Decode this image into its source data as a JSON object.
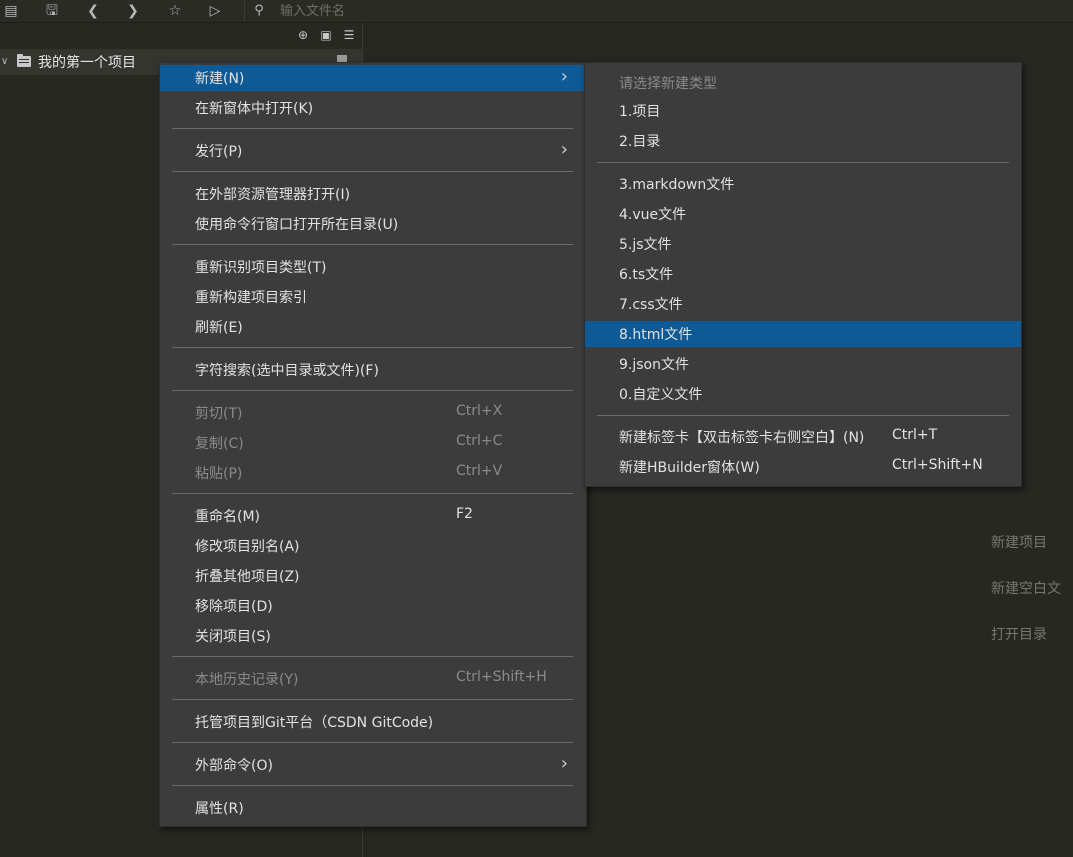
{
  "search": {
    "placeholder": "输入文件名"
  },
  "sidebar": {
    "project_name": "我的第一个项目"
  },
  "context_menu": {
    "items": [
      {
        "label": "新建(N)",
        "shortcut": "",
        "submenu": true,
        "disabled": false
      },
      {
        "label": "在新窗体中打开(K)",
        "shortcut": "",
        "submenu": false,
        "disabled": false
      },
      {
        "label": "发行(P)",
        "shortcut": "",
        "submenu": true,
        "disabled": false
      },
      {
        "label": "在外部资源管理器打开(I)",
        "shortcut": "",
        "submenu": false,
        "disabled": false
      },
      {
        "label": "使用命令行窗口打开所在目录(U)",
        "shortcut": "",
        "submenu": false,
        "disabled": false
      },
      {
        "label": "重新识别项目类型(T)",
        "shortcut": "",
        "submenu": false,
        "disabled": false
      },
      {
        "label": "重新构建项目索引",
        "shortcut": "",
        "submenu": false,
        "disabled": false
      },
      {
        "label": "刷新(E)",
        "shortcut": "",
        "submenu": false,
        "disabled": false
      },
      {
        "label": "字符搜索(选中目录或文件)(F)",
        "shortcut": "",
        "submenu": false,
        "disabled": false
      },
      {
        "label": "剪切(T)",
        "shortcut": "Ctrl+X",
        "submenu": false,
        "disabled": true
      },
      {
        "label": "复制(C)",
        "shortcut": "Ctrl+C",
        "submenu": false,
        "disabled": true
      },
      {
        "label": "粘贴(P)",
        "shortcut": "Ctrl+V",
        "submenu": false,
        "disabled": true
      },
      {
        "label": "重命名(M)",
        "shortcut": "F2",
        "submenu": false,
        "disabled": false
      },
      {
        "label": "修改项目别名(A)",
        "shortcut": "",
        "submenu": false,
        "disabled": false
      },
      {
        "label": "折叠其他项目(Z)",
        "shortcut": "",
        "submenu": false,
        "disabled": false
      },
      {
        "label": "移除项目(D)",
        "shortcut": "",
        "submenu": false,
        "disabled": false
      },
      {
        "label": "关闭项目(S)",
        "shortcut": "",
        "submenu": false,
        "disabled": false
      },
      {
        "label": "本地历史记录(Y)",
        "shortcut": "Ctrl+Shift+H",
        "submenu": false,
        "disabled": true
      },
      {
        "label": "托管项目到Git平台（CSDN GitCode)",
        "shortcut": "",
        "submenu": false,
        "disabled": false
      },
      {
        "label": "外部命令(O)",
        "shortcut": "",
        "submenu": true,
        "disabled": false
      },
      {
        "label": "属性(R)",
        "shortcut": "",
        "submenu": false,
        "disabled": false
      }
    ]
  },
  "new_submenu": {
    "header": "请选择新建类型",
    "items": [
      {
        "label": "1.项目",
        "shortcut": ""
      },
      {
        "label": "2.目录",
        "shortcut": ""
      },
      {
        "label": "3.markdown文件",
        "shortcut": ""
      },
      {
        "label": "4.vue文件",
        "shortcut": ""
      },
      {
        "label": "5.js文件",
        "shortcut": ""
      },
      {
        "label": "6.ts文件",
        "shortcut": ""
      },
      {
        "label": "7.css文件",
        "shortcut": ""
      },
      {
        "label": "8.html文件",
        "shortcut": ""
      },
      {
        "label": "9.json文件",
        "shortcut": ""
      },
      {
        "label": "0.自定义文件",
        "shortcut": ""
      },
      {
        "label": "新建标签卡【双击标签卡右侧空白】(N)",
        "shortcut": "Ctrl+T"
      },
      {
        "label": "新建HBuilder窗体(W)",
        "shortcut": "Ctrl+Shift+N"
      }
    ]
  },
  "welcome": {
    "new_project": "新建项目",
    "new_blank_file": "新建空白文",
    "open_directory": "打开目录"
  }
}
